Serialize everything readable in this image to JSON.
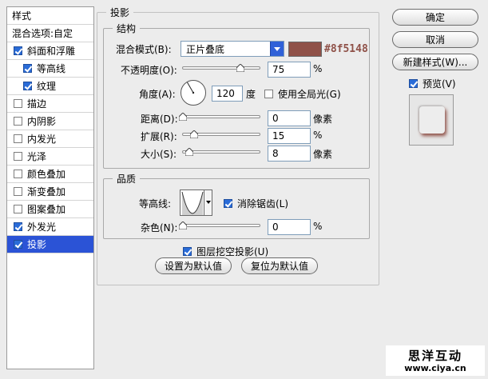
{
  "sidebar": {
    "items": [
      {
        "label": "样式",
        "type": "header"
      },
      {
        "label": "混合选项:自定",
        "type": "header"
      },
      {
        "label": "斜面和浮雕",
        "checked": true
      },
      {
        "label": "等高线",
        "checked": true,
        "sub": true
      },
      {
        "label": "纹理",
        "checked": true,
        "sub": true
      },
      {
        "label": "描边",
        "checked": false
      },
      {
        "label": "内阴影",
        "checked": false
      },
      {
        "label": "内发光",
        "checked": false
      },
      {
        "label": "光泽",
        "checked": false
      },
      {
        "label": "颜色叠加",
        "checked": false
      },
      {
        "label": "渐变叠加",
        "checked": false
      },
      {
        "label": "图案叠加",
        "checked": false
      },
      {
        "label": "外发光",
        "checked": true
      },
      {
        "label": "投影",
        "checked": true,
        "selected": true
      }
    ]
  },
  "panel": {
    "title": "投影",
    "structure": {
      "title": "结构",
      "blend_mode_label": "混合模式(B):",
      "blend_mode_value": "正片叠底",
      "color": "#8f5148",
      "color_hex_text": "#8f5148",
      "opacity_label": "不透明度(O):",
      "opacity_value": "75",
      "opacity_unit": "%",
      "angle_label": "角度(A):",
      "angle_value": "120",
      "angle_unit": "度",
      "global_light_label": "使用全局光(G)",
      "global_light_checked": false,
      "distance_label": "距离(D):",
      "distance_value": "0",
      "distance_unit": "像素",
      "spread_label": "扩展(R):",
      "spread_value": "15",
      "spread_unit": "%",
      "size_label": "大小(S):",
      "size_value": "8",
      "size_unit": "像素"
    },
    "quality": {
      "title": "品质",
      "contour_label": "等高线:",
      "anti_alias_label": "消除锯齿(L)",
      "anti_alias_checked": true,
      "noise_label": "杂色(N):",
      "noise_value": "0",
      "noise_unit": "%"
    },
    "knockout_label": "图层挖空投影(U)",
    "knockout_checked": true,
    "make_default_label": "设置为默认值",
    "reset_default_label": "复位为默认值"
  },
  "actions": {
    "ok_label": "确定",
    "cancel_label": "取消",
    "new_style_label": "新建样式(W)...",
    "preview_label": "预览(V)",
    "preview_checked": true
  },
  "watermark": {
    "title": "思洋互动",
    "url": "www.ciya.cn"
  }
}
